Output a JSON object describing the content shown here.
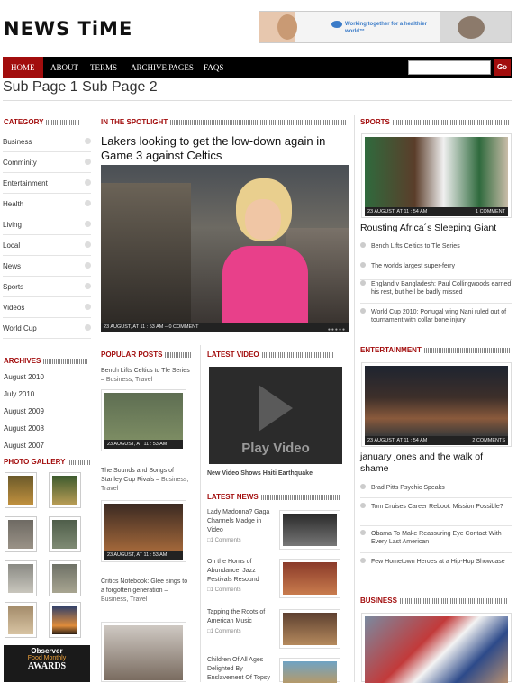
{
  "logo": "NEWS TiME",
  "banner": {
    "text": "Working together for a healthier world™"
  },
  "nav": {
    "items": [
      "HOME",
      "ABOUT",
      "TERMS",
      "ARCHIVE PAGES",
      "FAQS"
    ],
    "search_placeholder": "",
    "go_label": "Go"
  },
  "subnav": [
    "Sub Page 1",
    "Sub Page 2"
  ],
  "category": {
    "title": "CATEGORY",
    "items": [
      "Business",
      "Comminity",
      "Entertainment",
      "Health",
      "Living",
      "Local",
      "News",
      "Sports",
      "Videos",
      "World Cup"
    ]
  },
  "archives": {
    "title": "ARCHIVES",
    "items": [
      "August 2010",
      "July 2010",
      "August 2009",
      "August 2008",
      "August 2007"
    ]
  },
  "gallery": {
    "title": "PHOTO GALLERY"
  },
  "observer": {
    "line1": "Observer",
    "line2": "Food Monthly",
    "line3": "AWARDS"
  },
  "spotlight": {
    "title": "IN THE SPOTLIGHT",
    "headline": "Lakers looking to get the low-down again in Game 3 against Celtics",
    "caption": "23 AUGUST, AT 11 : 53 AM – 0 COMMENT"
  },
  "popular": {
    "title": "POPULAR POSTS",
    "items": [
      {
        "title": "Bench Lifts Celtics to Tle Series",
        "cats": "Business, Travel",
        "caption": "23 AUGUST, AT 11 : 53 AM"
      },
      {
        "title": "The Sounds and Songs of Stanley Cup Rivals",
        "cats": "Business, Travel",
        "caption": "23 AUGUST, AT 11 : 53 AM"
      },
      {
        "title": "Critics Notebook: Glee sings to a forgotten generation",
        "cats": "Business, Travel",
        "caption": ""
      }
    ]
  },
  "video": {
    "title": "LATEST VIDEO",
    "play_label": "Play Video",
    "caption": "New Video Shows Haiti Earthquake"
  },
  "latest": {
    "title": "LATEST NEWS",
    "items": [
      {
        "title": "Lady Madonna? Gaga Channels Madge in Video",
        "comments": "1 Comments"
      },
      {
        "title": "On the Horns of Abundance: Jazz Festivals Resound",
        "comments": "1 Comments"
      },
      {
        "title": "Tapping the Roots of American Music",
        "comments": "1 Comments"
      },
      {
        "title": "Children Of All Ages Delighted By Enslavement Of Topsy",
        "comments": ""
      }
    ]
  },
  "sports": {
    "title": "SPORTS",
    "caption_left": "23 AUGUST, AT 11 : 54 AM",
    "caption_right": "1 COMMENT",
    "headline": "Rousting Africa´s Sleeping Giant",
    "items": [
      "Bench Lifts Celtics to Tle Series",
      "The worlds largest super-ferry",
      "England v Bangladesh: Paul Collingwoods earned his rest, but hell be badly missed",
      "World Cup 2010: Portugal wing Nani ruled out of tournament with collar bone injury"
    ]
  },
  "entertainment": {
    "title": "ENTERTAINMENT",
    "caption_left": "23 AUGUST, AT 11 : 54 AM",
    "caption_right": "2 COMMENTS",
    "headline": "january jones and the walk of shame",
    "items": [
      "Brad Pitts Psychic Speaks",
      "Tom Cruises Career Reboot: Mission Possible?",
      "Obama To Make Reassuring Eye Contact With Every Last American",
      "Few Hometown Heroes at a Hip-Hop Showcase"
    ]
  },
  "business": {
    "title": "BUSINESS"
  }
}
